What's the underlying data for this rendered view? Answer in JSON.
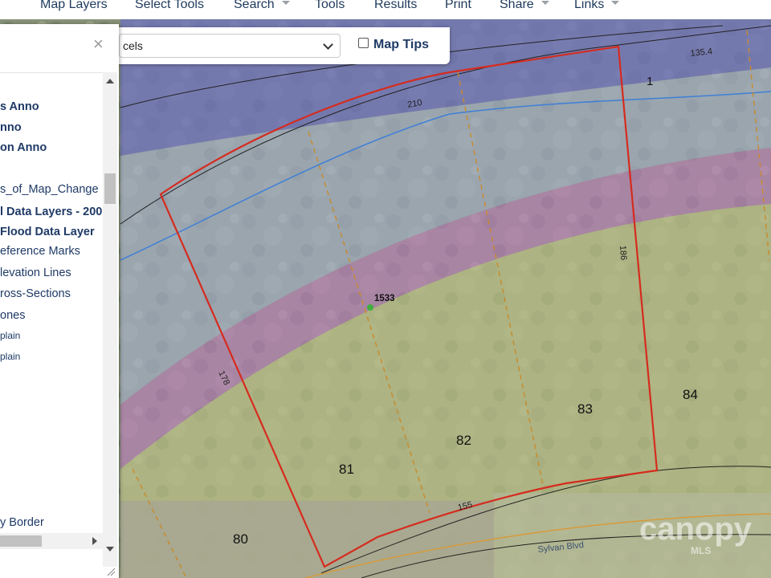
{
  "nav": {
    "items": [
      {
        "label": "Map Layers",
        "dropdown": false
      },
      {
        "label": "Select Tools",
        "dropdown": false
      },
      {
        "label": "Search",
        "dropdown": true
      },
      {
        "label": "Tools",
        "dropdown": false
      },
      {
        "label": "Results",
        "dropdown": false
      },
      {
        "label": "Print",
        "dropdown": false
      },
      {
        "label": "Share",
        "dropdown": true
      },
      {
        "label": "Links",
        "dropdown": true
      }
    ]
  },
  "layer_panel": {
    "close_glyph": "×",
    "items": [
      {
        "label": "s Anno",
        "style": "bold"
      },
      {
        "label": "nno",
        "style": "bold"
      },
      {
        "label": "on Anno",
        "style": "bold"
      },
      {
        "label": "s_of_Map_Change",
        "style": "normal"
      },
      {
        "label": "l Data Layers - 200",
        "style": "bold"
      },
      {
        "label": " Flood Data Layer",
        "style": "bold"
      },
      {
        "label": "eference Marks",
        "style": "normal"
      },
      {
        "label": "levation Lines",
        "style": "normal"
      },
      {
        "label": "ross-Sections",
        "style": "normal"
      },
      {
        "label": "ones",
        "style": "normal"
      },
      {
        "label": "plain",
        "style": "small"
      },
      {
        "label": "plain",
        "style": "small"
      },
      {
        "label": "y Border",
        "style": "normal"
      }
    ]
  },
  "toolbar": {
    "layer_select_value": "cels",
    "map_tips_label": "Map Tips",
    "map_tips_checked": false
  },
  "map": {
    "lot_labels": [
      "1",
      "80",
      "81",
      "82",
      "83",
      "84"
    ],
    "dimension_labels": [
      "135.4",
      "210",
      "186",
      "178",
      "155"
    ],
    "address_label": "1533",
    "street_label": "Sylvan Blvd",
    "watermark_text": "canopy",
    "watermark_sub": "MLS"
  },
  "colors": {
    "nav_text": "#1f3a5c",
    "panel_text": "#1e3a66",
    "parcel_outline": "#d62b1e",
    "flood_blue": "#6c6fc4",
    "flood_pink": "#c57ac8",
    "flood_yellow": "#c2c489"
  }
}
